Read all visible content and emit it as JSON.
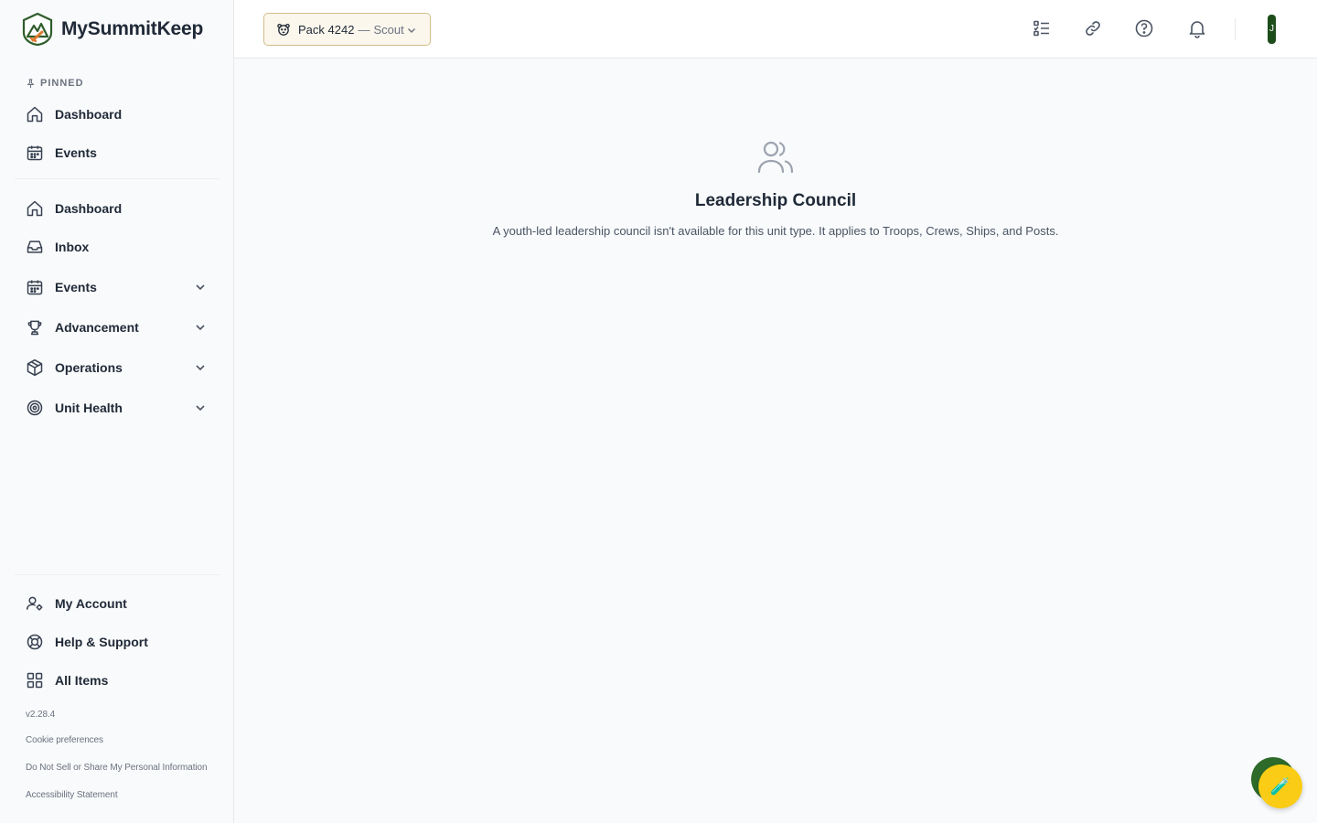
{
  "brand": {
    "name": "MySummitKeep"
  },
  "sidebar": {
    "pinned_label": "PINNED",
    "pinned_items": [
      {
        "label": "Dashboard",
        "icon": "home-icon"
      },
      {
        "label": "Events",
        "icon": "calendar-icon"
      }
    ],
    "items": [
      {
        "label": "Dashboard",
        "icon": "home-icon"
      },
      {
        "label": "Inbox",
        "icon": "inbox-icon"
      },
      {
        "label": "Events",
        "icon": "calendar-icon",
        "expandable": true
      },
      {
        "label": "Advancement",
        "icon": "trophy-icon",
        "expandable": true
      },
      {
        "label": "Operations",
        "icon": "box-icon",
        "expandable": true
      },
      {
        "label": "Unit Health",
        "icon": "target-icon",
        "expandable": true
      }
    ],
    "bottom_items": [
      {
        "label": "My Account",
        "icon": "user-settings-icon"
      },
      {
        "label": "Help & Support",
        "icon": "lifebuoy-icon"
      },
      {
        "label": "All Items",
        "icon": "grid-icon"
      }
    ],
    "version": "v2.28.4",
    "footer_links": [
      "Cookie preferences",
      "Do Not Sell or Share My Personal Information",
      "Accessibility Statement"
    ]
  },
  "topbar": {
    "unit_name": "Pack 4242",
    "unit_sep": "—",
    "unit_type": "Scout",
    "icons": [
      "checklist-icon",
      "link-icon",
      "help-circle-icon",
      "bell-icon"
    ],
    "avatar_initial": "J"
  },
  "main": {
    "title": "Leadership Council",
    "description": "A youth-led leadership council isn't available for this unit type. It applies to Troops, Crews, Ships, and Posts."
  },
  "colors": {
    "accent_dark_green": "#1e4d1c",
    "fab_green": "#2e6b2a",
    "fab_yellow": "#facc15",
    "unit_select_bg": "#fbf7ec",
    "unit_select_border": "#d1bd8a"
  }
}
